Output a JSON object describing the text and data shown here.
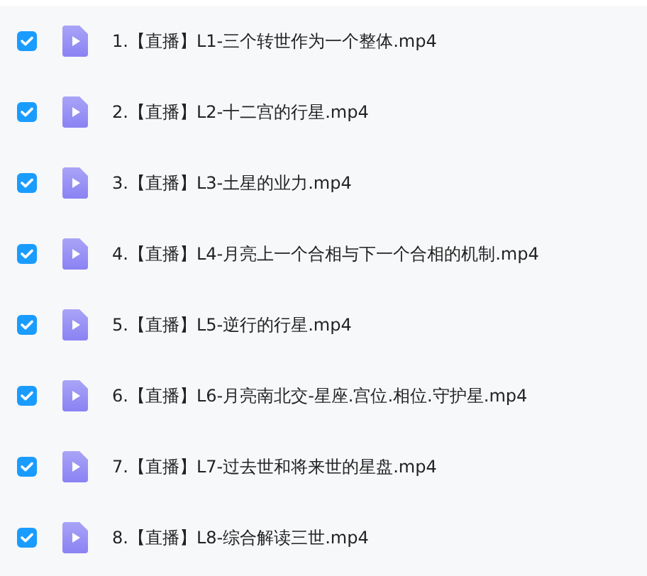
{
  "files": [
    {
      "name": "1.【直播】L1-三个转世作为一个整体.mp4",
      "checked": true
    },
    {
      "name": "2.【直播】L2-十二宫的行星.mp4",
      "checked": true
    },
    {
      "name": "3.【直播】L3-土星的业力.mp4",
      "checked": true
    },
    {
      "name": "4.【直播】L4-月亮上一个合相与下一个合相的机制.mp4",
      "checked": true
    },
    {
      "name": "5.【直播】L5-逆行的行星.mp4",
      "checked": true
    },
    {
      "name": "6.【直播】L6-月亮南北交-星座.宫位.相位.守护星.mp4",
      "checked": true
    },
    {
      "name": "7.【直播】L7-过去世和将来世的星盘.mp4",
      "checked": true
    },
    {
      "name": "8.【直播】L8-综合解读三世.mp4",
      "checked": true
    }
  ]
}
